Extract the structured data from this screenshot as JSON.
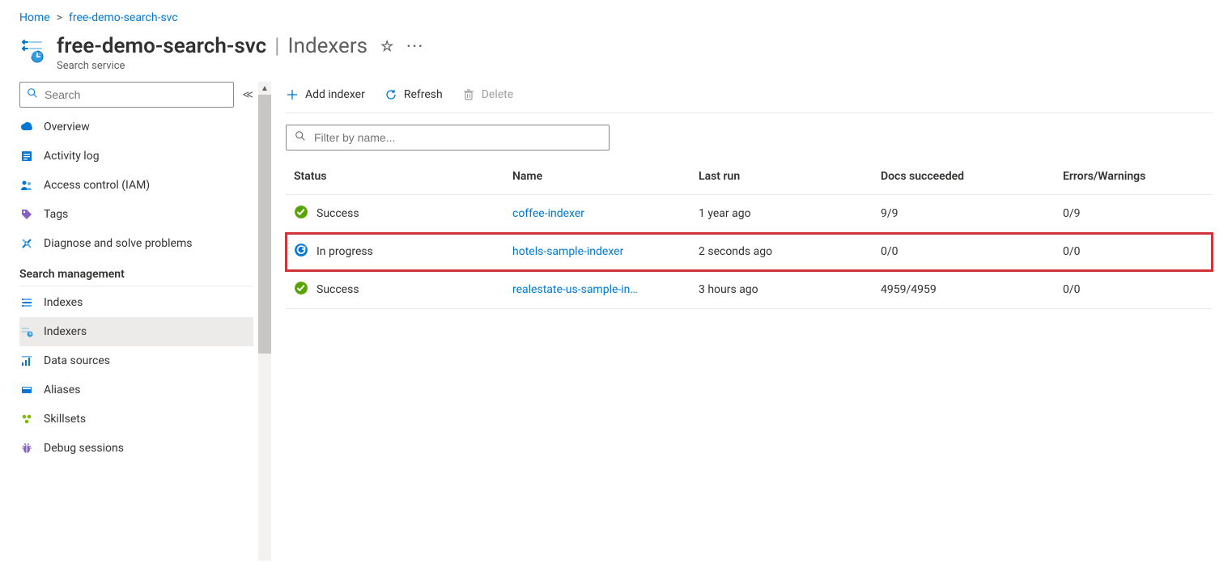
{
  "breadcrumb": {
    "home": "Home",
    "current": "free-demo-search-svc"
  },
  "header": {
    "title": "free-demo-search-svc",
    "section": "Indexers",
    "subtitle": "Search service"
  },
  "sidebar": {
    "search_placeholder": "Search",
    "items": [
      {
        "label": "Overview"
      },
      {
        "label": "Activity log"
      },
      {
        "label": "Access control (IAM)"
      },
      {
        "label": "Tags"
      },
      {
        "label": "Diagnose and solve problems"
      }
    ],
    "section_label": "Search management",
    "mgmt_items": [
      {
        "label": "Indexes"
      },
      {
        "label": "Indexers"
      },
      {
        "label": "Data sources"
      },
      {
        "label": "Aliases"
      },
      {
        "label": "Skillsets"
      },
      {
        "label": "Debug sessions"
      }
    ]
  },
  "toolbar": {
    "add": "Add indexer",
    "refresh": "Refresh",
    "delete": "Delete"
  },
  "filter": {
    "placeholder": "Filter by name..."
  },
  "table": {
    "headers": {
      "status": "Status",
      "name": "Name",
      "last_run": "Last run",
      "docs": "Docs succeeded",
      "errors": "Errors/Warnings"
    },
    "rows": [
      {
        "status": "Success",
        "status_kind": "success",
        "name": "coffee-indexer",
        "last_run": "1 year ago",
        "docs": "9/9",
        "errors": "0/9",
        "highlight": false
      },
      {
        "status": "In progress",
        "status_kind": "progress",
        "name": "hotels-sample-indexer",
        "last_run": "2 seconds ago",
        "docs": "0/0",
        "errors": "0/0",
        "highlight": true
      },
      {
        "status": "Success",
        "status_kind": "success",
        "name": "realestate-us-sample-in…",
        "last_run": "3 hours ago",
        "docs": "4959/4959",
        "errors": "0/0",
        "highlight": false
      }
    ]
  }
}
